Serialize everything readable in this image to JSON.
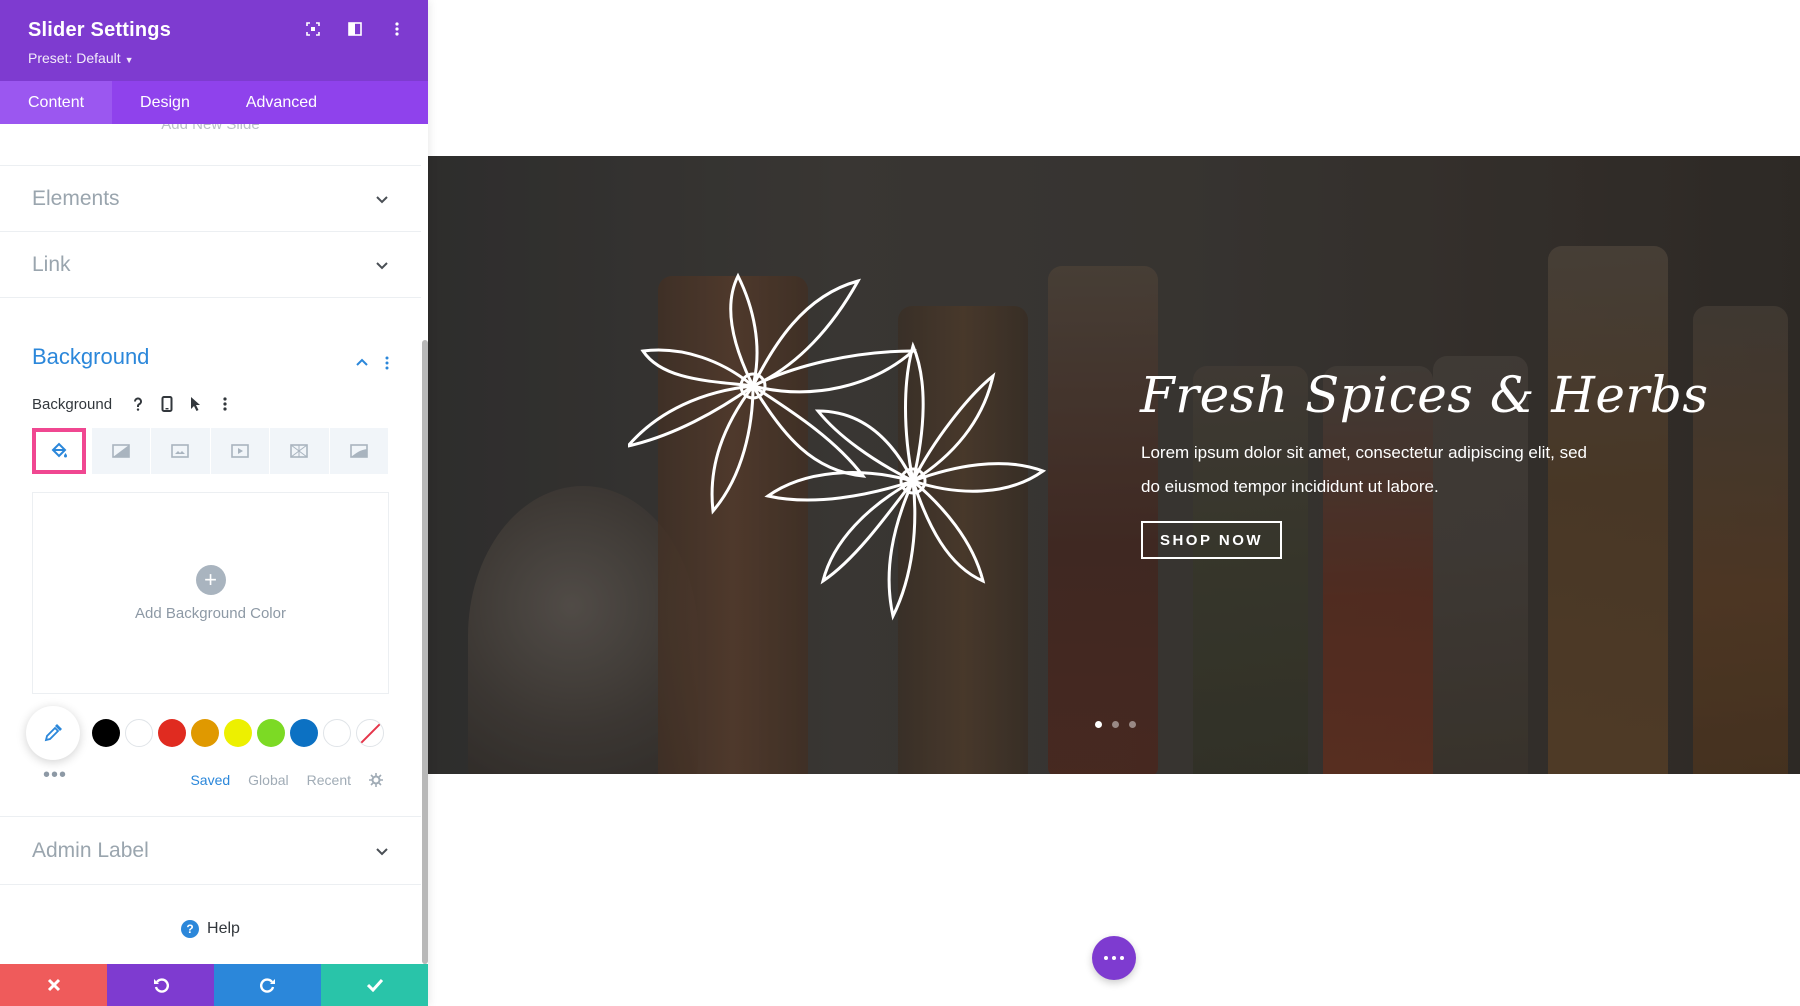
{
  "panel": {
    "title": "Slider Settings",
    "preset": "Preset: Default",
    "tabs": [
      {
        "label": "Content"
      },
      {
        "label": "Design"
      },
      {
        "label": "Advanced"
      }
    ],
    "cut_label": "Add New Slide",
    "sections": {
      "elements": "Elements",
      "link": "Link",
      "background": "Background",
      "admin_label": "Admin Label"
    },
    "background_label": "Background",
    "add_color_text": "Add Background Color",
    "swatches": [
      "#000000",
      "#ffffff",
      "#e02b20",
      "#e09900",
      "#edf000",
      "#7cda24",
      "#0c71c3",
      "#ffffff"
    ],
    "palette_tabs": {
      "saved": "Saved",
      "global": "Global",
      "recent": "Recent"
    },
    "help": "Help"
  },
  "slide": {
    "title": "Fresh Spices & Herbs",
    "body": "Lorem ipsum dolor sit amet, consectetur adipiscing elit, sed do eiusmod tempor incididunt ut labore.",
    "button": "SHOP NOW",
    "slide_count": 3,
    "active_slide": 1
  },
  "colors": {
    "accent": "#7e3bd0",
    "link_blue": "#2b87da",
    "highlight": "#f04791",
    "cancel": "#ef5b5b",
    "save": "#29c4a9"
  }
}
